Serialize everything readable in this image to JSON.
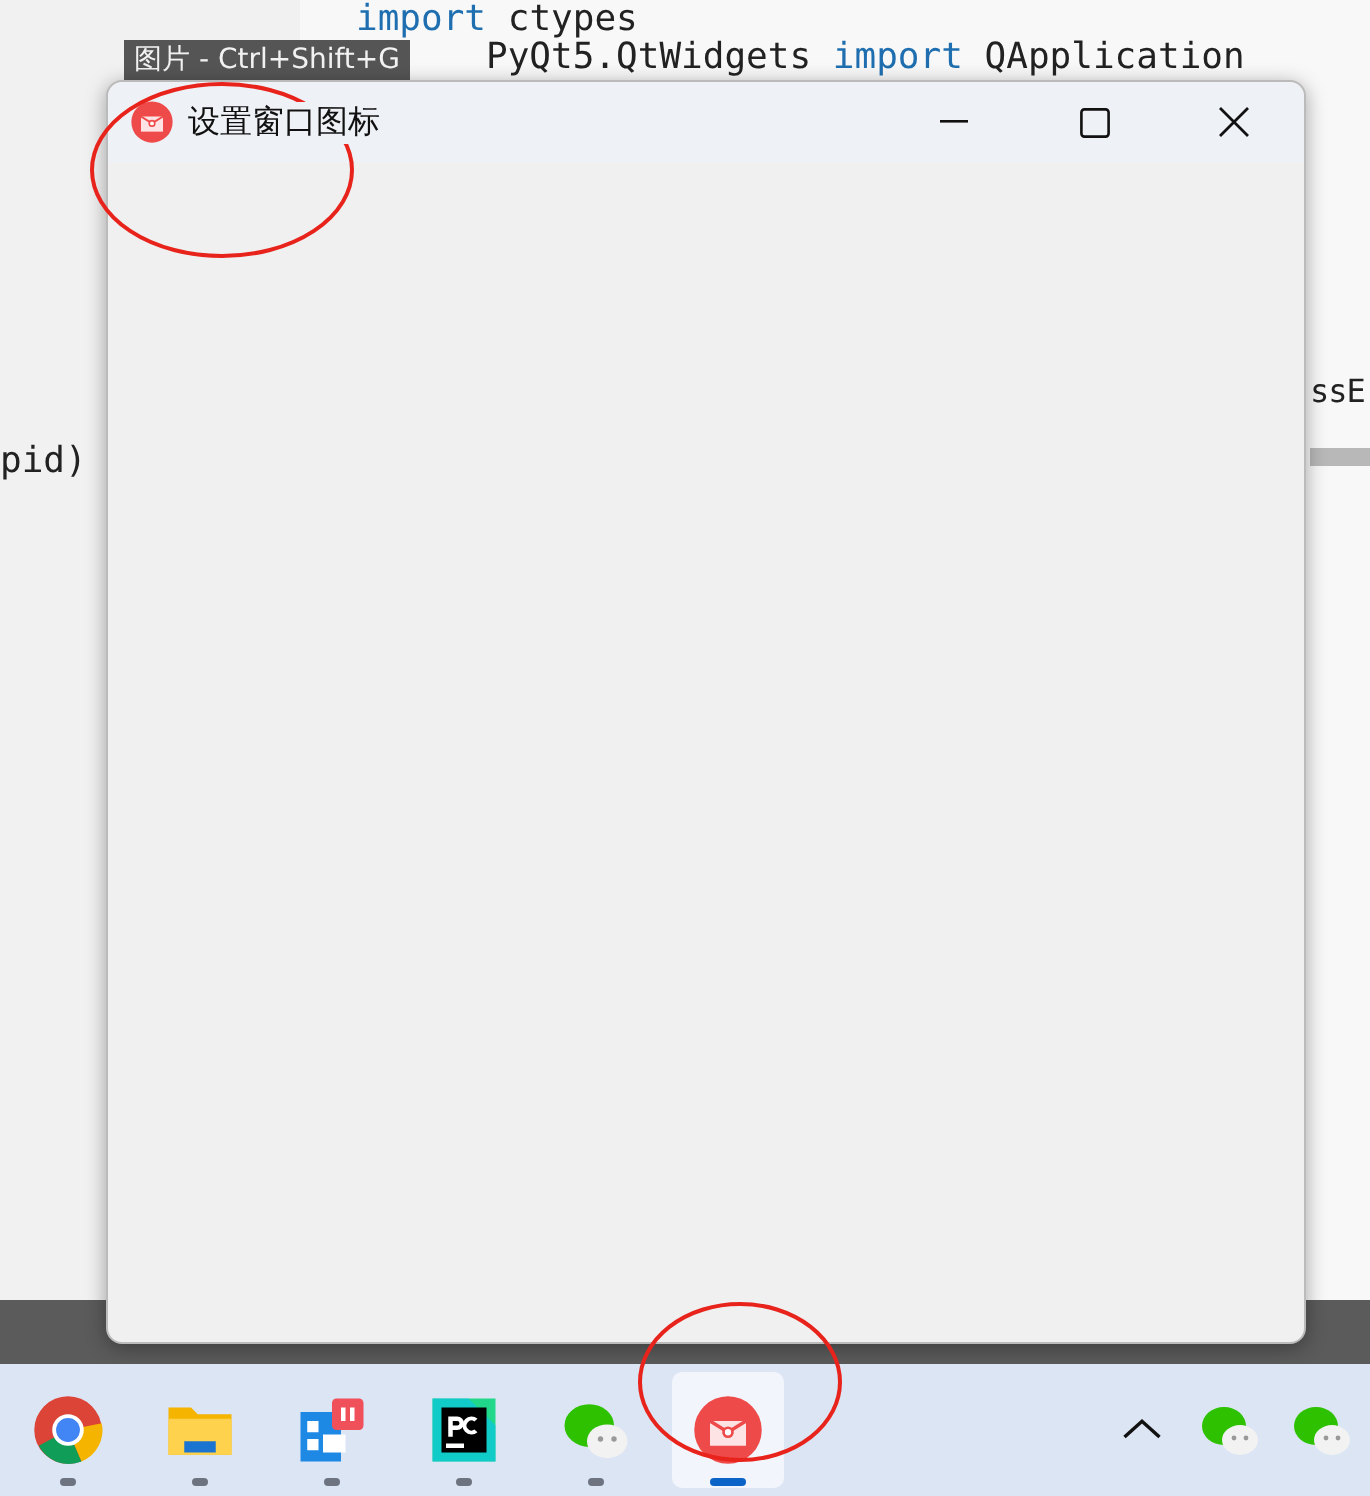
{
  "tooltip": {
    "text": "图片 - Ctrl+Shift+G"
  },
  "editor": {
    "lines": [
      {
        "kind": "top",
        "keyword": "import",
        "text": "ctypes"
      },
      {
        "kind": "head",
        "text": "PyQt5.QtWidgets",
        "keyword2": "import",
        "text2": "QApplication"
      },
      {
        "kind": "right",
        "text": "ssE"
      },
      {
        "kind": "left",
        "text": "pid)"
      }
    ]
  },
  "window": {
    "title": "设置窗口图标",
    "annotated": true
  },
  "taskbar": {
    "items": [
      {
        "kind": "chrome",
        "selected": false,
        "annotated": false
      },
      {
        "kind": "folder",
        "selected": false,
        "annotated": false
      },
      {
        "kind": "video",
        "selected": false,
        "annotated": false
      },
      {
        "kind": "pycharm",
        "selected": false,
        "annotated": false
      },
      {
        "kind": "chat",
        "selected": false,
        "annotated": false
      },
      {
        "kind": "app",
        "selected": true,
        "annotated": true
      }
    ],
    "tray": [
      {
        "kind": "chevron"
      },
      {
        "kind": "chat"
      },
      {
        "kind": "chat"
      }
    ]
  }
}
